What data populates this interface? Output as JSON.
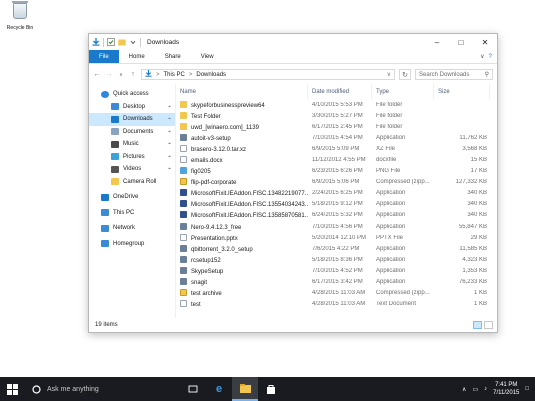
{
  "desktop": {
    "recycle_bin_label": "Recycle Bin"
  },
  "window": {
    "title": "Downloads",
    "ribbon_tabs": [
      "File",
      "Home",
      "Share",
      "View"
    ],
    "address": {
      "segments": [
        "This PC",
        "Downloads"
      ],
      "separator": ">"
    },
    "search_placeholder": "Search Downloads",
    "status": "19 items"
  },
  "sidebar": [
    {
      "label": "Quick access",
      "icon": "star-icon",
      "pinned": false
    },
    {
      "label": "Desktop",
      "icon": "desktop-icon",
      "pinned": true
    },
    {
      "label": "Downloads",
      "icon": "download-icon",
      "pinned": true,
      "selected": true
    },
    {
      "label": "Documents",
      "icon": "documents-icon",
      "pinned": true
    },
    {
      "label": "Music",
      "icon": "music-icon",
      "pinned": true
    },
    {
      "label": "Pictures",
      "icon": "pictures-icon",
      "pinned": true
    },
    {
      "label": "Videos",
      "icon": "videos-icon",
      "pinned": true
    },
    {
      "label": "Camera Roll",
      "icon": "folder-icon",
      "pinned": false
    },
    {
      "label": "OneDrive",
      "icon": "onedrive-icon",
      "pinned": false
    },
    {
      "label": "This PC",
      "icon": "pc-icon",
      "pinned": false
    },
    {
      "label": "Network",
      "icon": "network-icon",
      "pinned": false
    },
    {
      "label": "Homegroup",
      "icon": "homegroup-icon",
      "pinned": false
    }
  ],
  "columns": {
    "name": "Name",
    "date": "Date modified",
    "type": "Type",
    "size": "Size"
  },
  "files": [
    {
      "name": "skypeforbusinesspreview64",
      "date": "4/10/2015 5:53 PM",
      "type": "File folder",
      "size": "",
      "icon": "folder-icon"
    },
    {
      "name": "Test Folder",
      "date": "3/30/2015 5:27 PM",
      "type": "File folder",
      "size": "",
      "icon": "folder-icon"
    },
    {
      "name": "uwd_[winaero.com]_1139",
      "date": "6/17/2015 2:45 PM",
      "type": "File folder",
      "size": "",
      "icon": "folder-icon"
    },
    {
      "name": "autoit-v3-setup",
      "date": "7/10/2015 4:54 PM",
      "type": "Application",
      "size": "11,762 KB",
      "icon": "app-icon"
    },
    {
      "name": "brasero-3.12.0.tar.xz",
      "date": "6/9/2015 5:09 PM",
      "type": "XZ File",
      "size": "3,568 KB",
      "icon": "file-icon"
    },
    {
      "name": "emails.docx",
      "date": "11/12/2012 4:55 PM",
      "type": "docxfile",
      "size": "15 KB",
      "icon": "file-icon"
    },
    {
      "name": "fig0205",
      "date": "6/23/2015 6:26 PM",
      "type": "PNG File",
      "size": "17 KB",
      "icon": "image-icon"
    },
    {
      "name": "flip-pdf-corporate",
      "date": "6/9/2015 5:06 PM",
      "type": "Compressed (zipp...",
      "size": "127,332 KB",
      "icon": "zip-icon"
    },
    {
      "name": "MicrosoftFixit.IEAddon.FISC.13482219077...",
      "date": "2/24/2015 6:25 PM",
      "type": "Application",
      "size": "340 KB",
      "icon": "fixit-icon"
    },
    {
      "name": "MicrosoftFixit.IEAddon.FISC.13554034243...",
      "date": "5/18/2015 9:12 PM",
      "type": "Application",
      "size": "340 KB",
      "icon": "fixit-icon"
    },
    {
      "name": "MicrosoftFixit.IEAddon.FISC.13585870581...",
      "date": "6/24/2015 5:32 PM",
      "type": "Application",
      "size": "340 KB",
      "icon": "fixit-icon"
    },
    {
      "name": "Nero-9.4.12.3_free",
      "date": "7/10/2015 4:56 PM",
      "type": "Application",
      "size": "55,847 KB",
      "icon": "app-icon"
    },
    {
      "name": "Presentation.pptx",
      "date": "5/20/2014 12:10 PM",
      "type": "PPTX File",
      "size": "29 KB",
      "icon": "file-icon"
    },
    {
      "name": "qbittorrent_3.2.0_setup",
      "date": "7/6/2015 4:22 PM",
      "type": "Application",
      "size": "11,585 KB",
      "icon": "app-icon"
    },
    {
      "name": "rcsetup152",
      "date": "5/18/2015 8:36 PM",
      "type": "Application",
      "size": "4,323 KB",
      "icon": "app-icon"
    },
    {
      "name": "SkypeSetup",
      "date": "7/10/2015 4:52 PM",
      "type": "Application",
      "size": "1,353 KB",
      "icon": "app-icon"
    },
    {
      "name": "snagit",
      "date": "6/17/2015 3:42 PM",
      "type": "Application",
      "size": "76,233 KB",
      "icon": "app-icon"
    },
    {
      "name": "test archive",
      "date": "4/28/2015 11:03 AM",
      "type": "Compressed (zipp...",
      "size": "1 KB",
      "icon": "zip-icon"
    },
    {
      "name": "test",
      "date": "4/28/2015 11:03 AM",
      "type": "Text Document",
      "size": "1 KB",
      "icon": "file-icon"
    }
  ],
  "taskbar": {
    "search_placeholder": "Ask me anything",
    "time": "7:41 PM",
    "date": "7/11/2015"
  },
  "colors": {
    "accent": "#1979ca",
    "selection": "#cce8ff",
    "folder": "#f3c74d",
    "taskbar": "#191b21"
  }
}
